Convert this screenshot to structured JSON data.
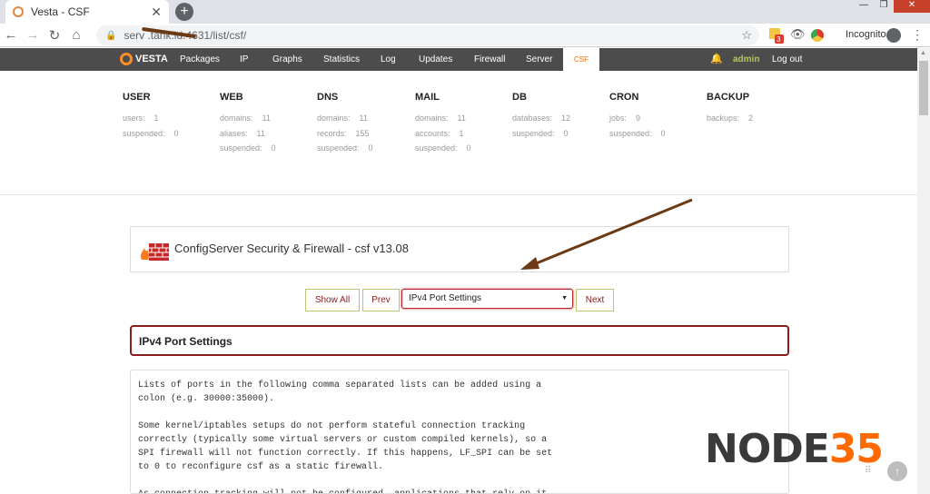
{
  "browser": {
    "tab_title": "Vesta - CSF",
    "url": "serv        .tank.id:4631/list/csf/",
    "incognito_label": "Incognito",
    "ext_badge": "3"
  },
  "topnav": {
    "logo": "VESTA",
    "items": [
      "Packages",
      "IP",
      "Graphs",
      "Statistics",
      "Log",
      "Updates",
      "Firewall",
      "Server",
      "CSF"
    ],
    "active": "CSF",
    "user": "admin",
    "logout": "Log out"
  },
  "stats": [
    {
      "title": "USER",
      "rows": [
        [
          "users:",
          "1"
        ],
        [
          "suspended:",
          "0"
        ]
      ]
    },
    {
      "title": "WEB",
      "rows": [
        [
          "domains:",
          "11"
        ],
        [
          "aliases:",
          "11"
        ],
        [
          "suspended:",
          "0"
        ]
      ]
    },
    {
      "title": "DNS",
      "rows": [
        [
          "domains:",
          "11"
        ],
        [
          "records:",
          "155"
        ],
        [
          "suspended:",
          "0"
        ]
      ]
    },
    {
      "title": "MAIL",
      "rows": [
        [
          "domains:",
          "11"
        ],
        [
          "accounts:",
          "1"
        ],
        [
          "suspended:",
          "0"
        ]
      ]
    },
    {
      "title": "DB",
      "rows": [
        [
          "databases:",
          "12"
        ],
        [
          "suspended:",
          "0"
        ]
      ]
    },
    {
      "title": "CRON",
      "rows": [
        [
          "jobs:",
          "9"
        ],
        [
          "suspended:",
          "0"
        ]
      ]
    },
    {
      "title": "BACKUP",
      "rows": [
        [
          "backups:",
          "2"
        ]
      ]
    }
  ],
  "csf": {
    "title": "ConfigServer Security & Firewall - csf v13.08",
    "show_all": "Show All",
    "prev": "Prev",
    "select_value": "IPv4 Port Settings",
    "next": "Next",
    "section_title": "IPv4 Port Settings",
    "body_text": "Lists of ports in the following comma separated lists can be added using a\ncolon (e.g. 30000:35000).\n\nSome kernel/iptables setups do not perform stateful connection tracking\ncorrectly (typically some virtual servers or custom compiled kernels), so a\nSPI firewall will not function correctly. If this happens, LF_SPI can be set\nto 0 to reconfigure csf as a static firewall.\n\nAs connection tracking will not be configured, applications that rely on it"
  },
  "watermark": {
    "part1": "NODE",
    "part2": "35"
  },
  "colors": {
    "accent": "#ff6a00",
    "nav_bg": "#4c4c4c",
    "border_red": "#8b1c1c",
    "arrow": "#6b3a14"
  }
}
